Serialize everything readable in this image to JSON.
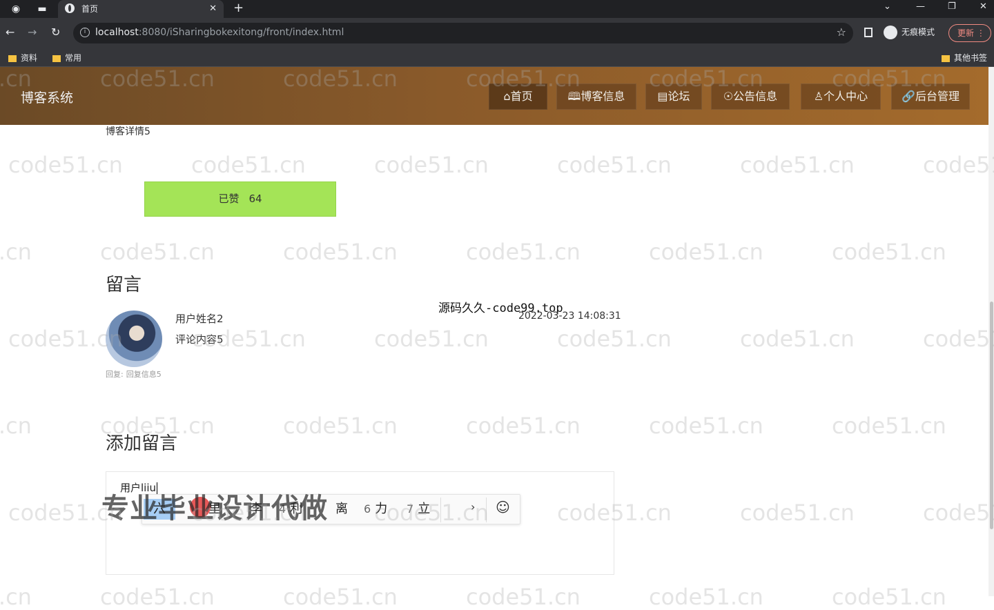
{
  "browser": {
    "tab_title": "首页",
    "url_host": "localhost",
    "url_rest": ":8080/iSharingbokexitong/front/index.html",
    "incognito_label": "无痕模式",
    "update_label": "更新",
    "bookmarks": [
      "资料",
      "常用"
    ],
    "other_bookmarks": "其他书签"
  },
  "site": {
    "brand": "博客系统",
    "nav": [
      {
        "label": "首页",
        "icon": "home-icon"
      },
      {
        "label": "博客信息",
        "icon": "book-icon"
      },
      {
        "label": "论坛",
        "icon": "forum-icon"
      },
      {
        "label": "公告信息",
        "icon": "notice-icon"
      },
      {
        "label": "个人中心",
        "icon": "user-icon"
      },
      {
        "label": "后台管理",
        "icon": "link-icon"
      }
    ]
  },
  "detail": {
    "title": "博客详情5",
    "like_label": "已赞",
    "like_count": "64"
  },
  "comments": {
    "heading": "留言",
    "items": [
      {
        "user": "用户姓名2",
        "content": "评论内容5",
        "reply_label": "回复:",
        "reply": "回复信息5",
        "site_text": "源码久久-code99.top",
        "time": "2022-03-23 14:08:31"
      }
    ]
  },
  "add_comment": {
    "heading": "添加留言",
    "typed_value": "用户liiu"
  },
  "ime": {
    "candidates": [
      {
        "num": "",
        "text": "六"
      },
      {
        "num": "",
        "text": "里"
      },
      {
        "num": "",
        "text": "李"
      },
      {
        "num": "4",
        "text": "利"
      },
      {
        "num": "",
        "text": "离"
      },
      {
        "num": "6",
        "text": "力"
      },
      {
        "num": "7",
        "text": "立"
      }
    ]
  },
  "overlay": "专业毕业设计代做",
  "watermark": "code51.cn"
}
